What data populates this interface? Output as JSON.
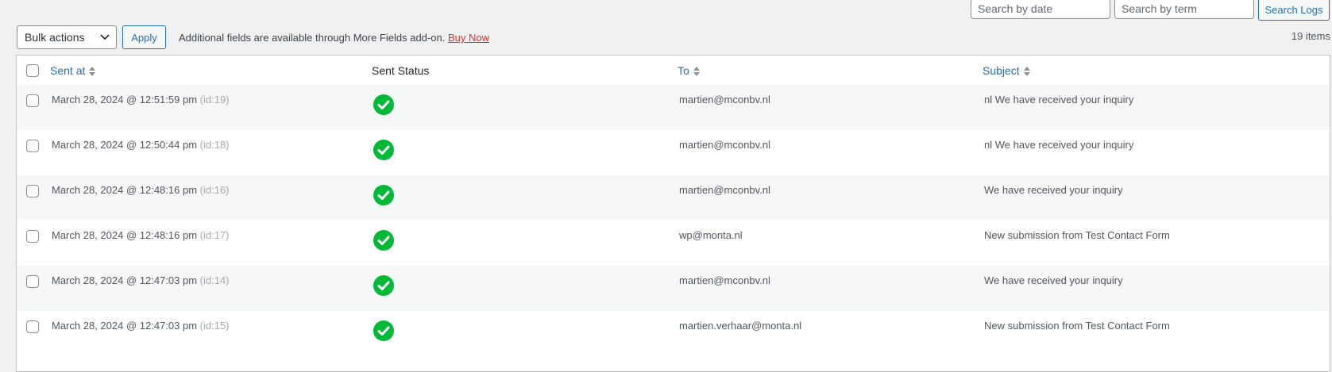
{
  "toolbar": {
    "search_date_placeholder": "Search by date",
    "search_term_placeholder": "Search by term",
    "search_button": "Search Logs",
    "bulk_actions": "Bulk actions",
    "apply": "Apply",
    "notice_text": "Additional fields are available through More Fields add-on.",
    "notice_link": "Buy Now",
    "items_count": "19 items"
  },
  "table": {
    "headers": {
      "sent_at": "Sent at",
      "sent_status": "Sent Status",
      "to": "To",
      "subject": "Subject"
    },
    "rows": [
      {
        "sent_at": "March 28, 2024 @ 12:51:59 pm",
        "id": "(id:19)",
        "status": "success-check-icon",
        "to": "martien@mconbv.nl",
        "subject": "nl We have received your inquiry"
      },
      {
        "sent_at": "March 28, 2024 @ 12:50:44 pm",
        "id": "(id:18)",
        "status": "success-check-icon",
        "to": "martien@mconbv.nl",
        "subject": "nl We have received your inquiry"
      },
      {
        "sent_at": "March 28, 2024 @ 12:48:16 pm",
        "id": "(id:16)",
        "status": "success-check-icon",
        "to": "martien@mconbv.nl",
        "subject": "We have received your inquiry"
      },
      {
        "sent_at": "March 28, 2024 @ 12:48:16 pm",
        "id": "(id:17)",
        "status": "success-check-icon",
        "to": "wp@monta.nl",
        "subject": "New submission from Test Contact Form"
      },
      {
        "sent_at": "March 28, 2024 @ 12:47:03 pm",
        "id": "(id:14)",
        "status": "success-check-icon",
        "to": "martien@mconbv.nl",
        "subject": "We have received your inquiry"
      },
      {
        "sent_at": "March 28, 2024 @ 12:47:03 pm",
        "id": "(id:15)",
        "status": "success-check-icon",
        "to": "martien.verhaar@monta.nl",
        "subject": "New submission from Test Contact Form"
      }
    ]
  },
  "colors": {
    "link": "#2271b1",
    "success": "#00ba37",
    "danger": "#d63638",
    "row_alt": "#f6f7f7"
  }
}
